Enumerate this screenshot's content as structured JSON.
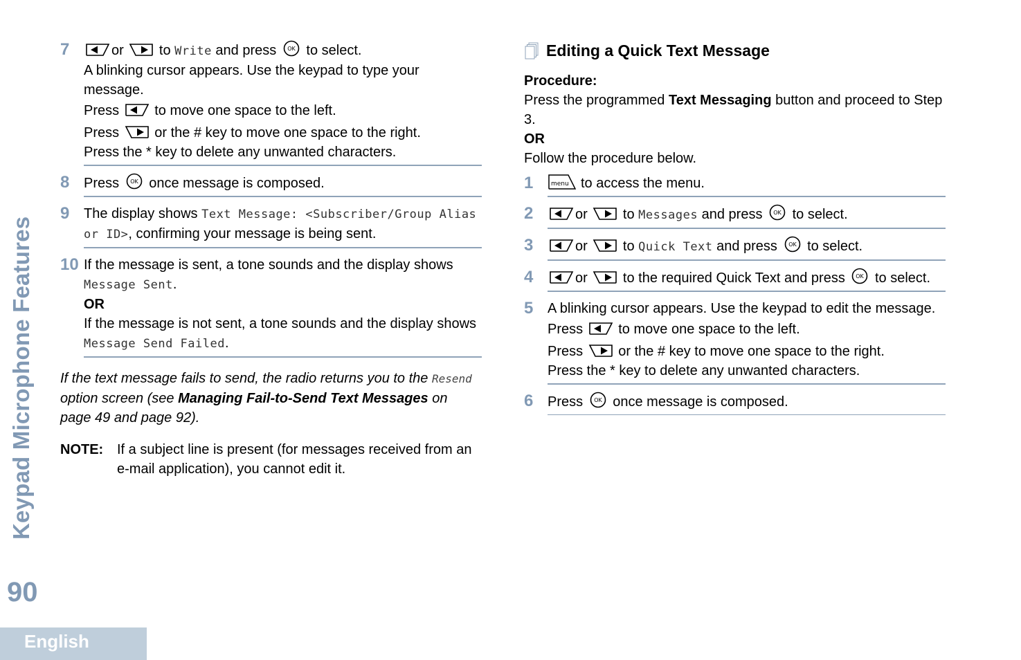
{
  "sidebar": {
    "chapter_title": "Keypad Microphone Features",
    "page_number": "90",
    "language": "English"
  },
  "left": {
    "steps": [
      {
        "num": "7",
        "l1_a": "or",
        "l1_b": "to",
        "l1_display": "Write",
        "l1_c": "and press",
        "l1_d": "to select.",
        "l2": "A blinking cursor appears. Use the keypad to type your message.",
        "l3_a": "Press",
        "l3_b": "to move one space to the left.",
        "l4_a": "Press",
        "l4_b": "or the # key to move one space to the right.",
        "l5": "Press the * key to delete any unwanted characters."
      },
      {
        "num": "8",
        "a": "Press",
        "b": "once message is composed."
      },
      {
        "num": "9",
        "a": "The display shows",
        "display": "Text Message: <Subscriber/Group Alias or ID>",
        "b": ", confirming your message is being sent."
      },
      {
        "num": "10",
        "a": "If the message is sent, a tone sounds and the display shows",
        "display1": "Message Sent",
        "dot1": ".",
        "or": "OR",
        "b": "If the message is not sent, a tone sounds and the display shows",
        "display2": "Message Send Failed",
        "dot2": "."
      }
    ],
    "italic_note": {
      "a": "If the text message fails to send, the radio returns you to the",
      "display": "Resend",
      "b": "option screen (see",
      "link": "Managing Fail-to-Send Text Messages",
      "c": "on page 49 and page 92)."
    },
    "note": {
      "label": "NOTE:",
      "text": "If a subject line is present (for messages received from an e-mail application), you cannot edit it."
    }
  },
  "right": {
    "heading": "Editing a Quick Text Message",
    "procedure_label": "Procedure:",
    "intro_a": "Press the programmed",
    "intro_bold": "Text Messaging",
    "intro_b": "button and proceed to Step 3.",
    "or": "OR",
    "intro_c": "Follow the procedure below.",
    "steps": [
      {
        "num": "1",
        "key_label": "menu",
        "text": "to access the menu."
      },
      {
        "num": "2",
        "a": "or",
        "b": "to",
        "display": "Messages",
        "c": "and press",
        "d": "to select."
      },
      {
        "num": "3",
        "a": "or",
        "b": "to",
        "display": "Quick Text",
        "c": "and press",
        "d": "to select."
      },
      {
        "num": "4",
        "a": "or",
        "b": "to the required Quick Text and press",
        "d": "to select."
      },
      {
        "num": "5",
        "l1": "A blinking cursor appears. Use the keypad to edit the message.",
        "l2_a": "Press",
        "l2_b": "to move one space to the left.",
        "l3_a": "Press",
        "l3_b": "or the # key to move one space to the right.",
        "l4": "Press the * key to delete any unwanted characters."
      },
      {
        "num": "6",
        "a": "Press",
        "b": "once message is composed."
      }
    ]
  },
  "icons": {
    "left_key": "left-arrow-key-icon",
    "right_key": "right-arrow-key-icon",
    "ok_key": "ok-button-icon",
    "menu_key": "menu-key-icon",
    "heading_icon": "document-stack-icon",
    "ok_label": "OK"
  },
  "colors": {
    "accent": "#8199b4",
    "rule": "#8fa3b8",
    "lang_tab": "#bfcedb"
  }
}
